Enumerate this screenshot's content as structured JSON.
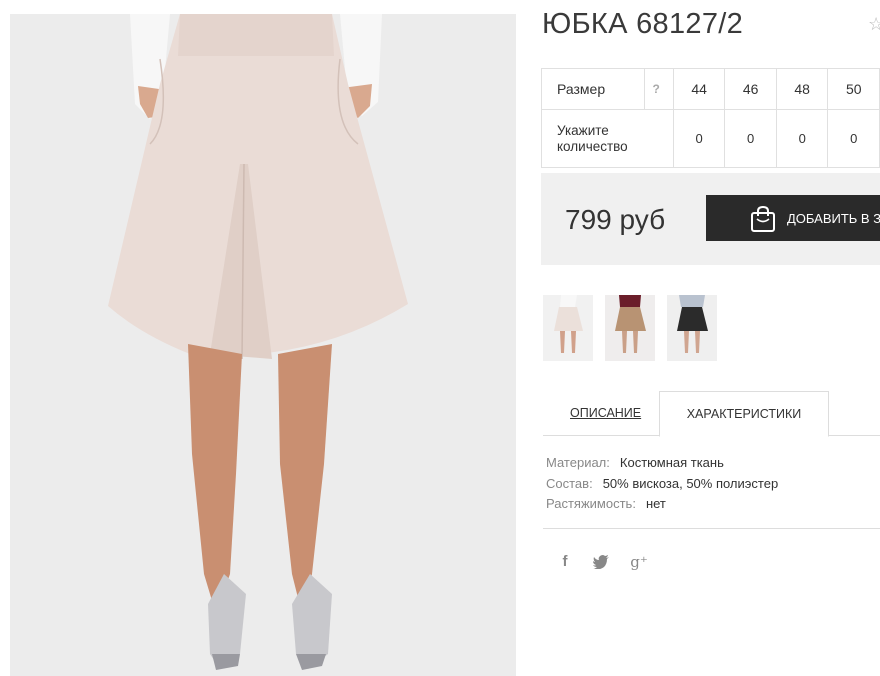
{
  "product": {
    "title": "ЮБКА 68127/2"
  },
  "size_table": {
    "size_label": "Размер",
    "help_glyph": "?",
    "sizes": [
      "44",
      "46",
      "48",
      "50"
    ],
    "qty_label_line1": "Укажите",
    "qty_label_line2": "количество",
    "quantities": [
      "0",
      "0",
      "0",
      "0"
    ]
  },
  "purchase": {
    "price": "799 руб",
    "add_button": "ДОБАВИТЬ В ЗА"
  },
  "tabs": {
    "description": "ОПИСАНИЕ",
    "characteristics": "ХАРАКТЕРИСТИКИ"
  },
  "specs": [
    {
      "key": "Материал:",
      "value": "Костюмная ткань"
    },
    {
      "key": "Состав:",
      "value": "50% вискоза, 50% полиэстер"
    },
    {
      "key": "Растяжимость:",
      "value": "нет"
    }
  ],
  "social": {
    "facebook_glyph": "f",
    "google_glyph": "g⁺"
  },
  "colors": {
    "skirt": "#eadcd6",
    "button": "#2a2a2a",
    "price_panel": "#f0f0f0"
  }
}
